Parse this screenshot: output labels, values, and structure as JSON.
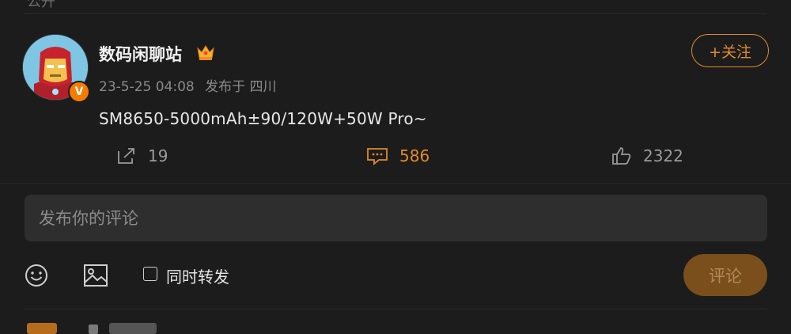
{
  "previous_item": {
    "clipped_text": "公开"
  },
  "post": {
    "username": "数码闲聊站",
    "vip_badge": "V",
    "date": "23-5-25 04:08",
    "source": "发布于 四川",
    "text": "SM8650-5000mAh±90/120W+50W Pro~",
    "follow_label": "+关注",
    "actions": {
      "repost_count": "19",
      "comment_count": "586",
      "like_count": "2322"
    }
  },
  "composer": {
    "placeholder": "发布你的评论",
    "repost_label": "同时转发",
    "submit_label": "评论"
  },
  "colors": {
    "background": "#1c1c1c",
    "accent": "#e08a2a",
    "submit_bg": "#7a4f1c",
    "input_bg": "#2e2e2e"
  },
  "icons": [
    "crown-icon",
    "repost-icon",
    "comment-icon",
    "like-icon",
    "emoji-icon",
    "image-icon",
    "checkbox-icon"
  ]
}
